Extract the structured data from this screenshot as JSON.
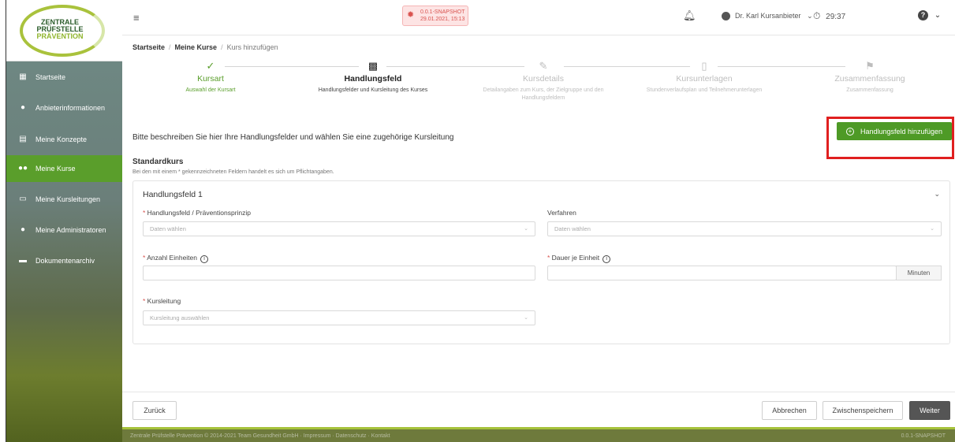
{
  "logo": {
    "line1": "ZENTRALE",
    "line2": "PRÜFSTELLE",
    "line3": "PRÄVENTION"
  },
  "sidebar": {
    "items": [
      {
        "label": "Startseite",
        "icon": "dashboard-icon"
      },
      {
        "label": "Anbieterinformationen",
        "icon": "person-icon"
      },
      {
        "label": "Meine Konzepte",
        "icon": "calendar-icon"
      },
      {
        "label": "Meine Kurse",
        "icon": "group-icon",
        "active": true
      },
      {
        "label": "Meine Kursleitungen",
        "icon": "contact-card-icon"
      },
      {
        "label": "Meine Administratoren",
        "icon": "admin-icon"
      },
      {
        "label": "Dokumentenarchiv",
        "icon": "archive-icon"
      }
    ]
  },
  "header": {
    "snapshot_version": "0.0.1-SNAPSHOT",
    "snapshot_date": "29.01.2021, 15:13",
    "user_name": "Dr. Karl Kursanbieter",
    "timer": "29:37"
  },
  "breadcrumb": {
    "home": "Startseite",
    "courses": "Meine Kurse",
    "current": "Kurs hinzufügen"
  },
  "stepper": [
    {
      "title": "Kursart",
      "subtitle": "Auswahl der Kursart",
      "state": "done",
      "icon": "check-icon"
    },
    {
      "title": "Handlungsfeld",
      "subtitle": "Handlungsfelder und Kursleitung des Kurses",
      "state": "current",
      "icon": "checkered-flag-icon"
    },
    {
      "title": "Kursdetails",
      "subtitle": "Detailangaben zum Kurs, der Zielgruppe und den Handlungsfeldern",
      "state": "todo",
      "icon": "edit-document-icon"
    },
    {
      "title": "Kursunterlagen",
      "subtitle": "Stundenverlaufsplan und Teilnehmerunterlagen",
      "state": "todo",
      "icon": "document-icon"
    },
    {
      "title": "Zusammenfassung",
      "subtitle": "Zusammenfassung",
      "state": "todo",
      "icon": "flag-icon"
    }
  ],
  "main": {
    "description": "Bitte beschreiben Sie hier Ihre Handlungsfelder und wählen Sie eine zugehörige Kursleitung",
    "add_button": "Handlungsfeld hinzufügen",
    "section_title": "Standardkurs",
    "required_note": "Bei den mit einem * gekennzeichneten Feldern handelt es sich um Pflichtangaben."
  },
  "card": {
    "title": "Handlungsfeld 1",
    "fields": {
      "handlungsfeld_label": "Handlungsfeld / Präventionsprinzip",
      "handlungsfeld_placeholder": "Daten wählen",
      "verfahren_label": "Verfahren",
      "verfahren_placeholder": "Daten wählen",
      "anzahl_label": "Anzahl Einheiten",
      "dauer_label": "Dauer je Einheit",
      "dauer_unit": "Minuten",
      "kursleitung_label": "Kursleitung",
      "kursleitung_placeholder": "Kursleitung auswählen"
    }
  },
  "footer_buttons": {
    "back": "Zurück",
    "cancel": "Abbrechen",
    "save": "Zwischenspeichern",
    "next": "Weiter"
  },
  "footer": {
    "text": "Zentrale Prüfstelle Prävention © 2014-2021 Team Gesundheit GmbH  ·  Impressum  ·  Datenschutz  ·  Kontakt",
    "version": "0.0.1-SNAPSHOT"
  },
  "colors": {
    "accent": "#5a9e2b",
    "highlight": "#e01f1f",
    "required": "#d9534f"
  }
}
